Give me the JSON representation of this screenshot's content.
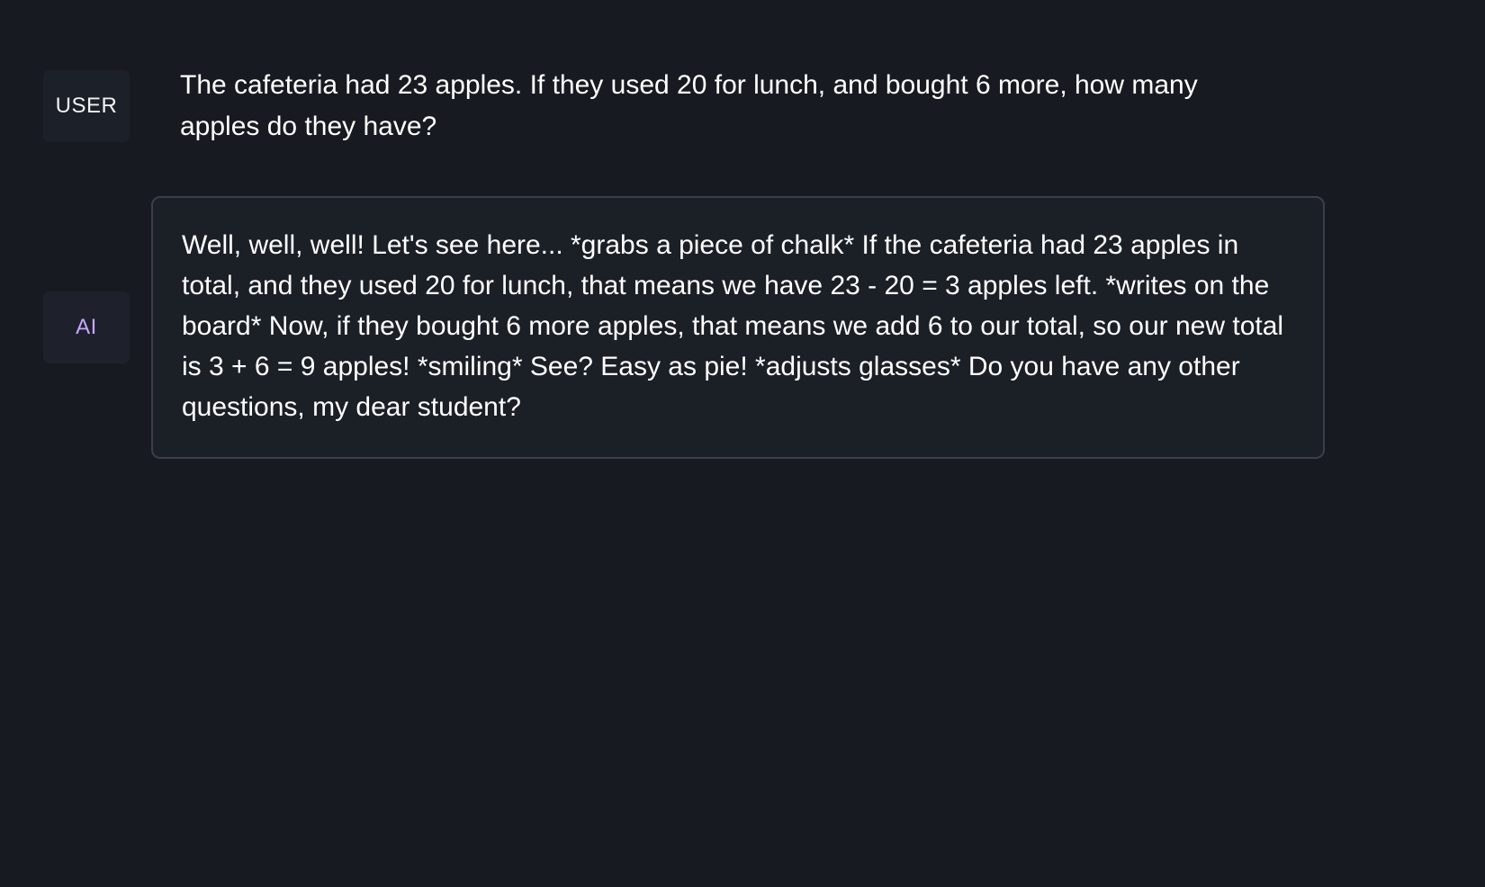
{
  "messages": {
    "user": {
      "role_label": "USER",
      "text": "The cafeteria had 23 apples. If they used 20 for lunch, and bought 6 more, how many apples do they have?"
    },
    "ai": {
      "role_label": "AI",
      "text": "Well, well, well! Let's see here... *grabs a piece of chalk* If the cafeteria had 23 apples in total, and they used 20 for lunch, that means we have 23 - 20 = 3 apples left. *writes on the board* Now, if they bought 6 more apples, that means we add 6 to our total, so our new total is 3 + 6 = 9 apples! *smiling* See? Easy as pie! *adjusts glasses* Do you have any other questions, my dear student?"
    }
  },
  "colors": {
    "background": "#171b21",
    "user_badge_bg": "#1c2028",
    "ai_badge_bg": "#1e212c",
    "ai_label": "#c9a7ff",
    "bubble_border": "#3a3f48",
    "text": "#ffffff"
  }
}
